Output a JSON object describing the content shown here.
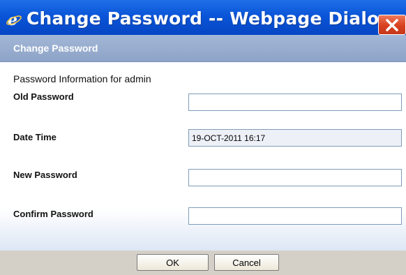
{
  "window": {
    "title": "Change Password -- Webpage Dialog",
    "app_icon": "ie-icon",
    "close_icon": "close-icon"
  },
  "header": {
    "title": "Change Password"
  },
  "form": {
    "info": "Password Information for admin",
    "old_password": {
      "label": "Old Password",
      "value": ""
    },
    "date_time": {
      "label": "Date Time",
      "value": "19-OCT-2011 16:17"
    },
    "new_password": {
      "label": "New Password",
      "value": ""
    },
    "confirm_password": {
      "label": "Confirm Password",
      "value": ""
    }
  },
  "buttons": {
    "ok": "OK",
    "cancel": "Cancel"
  },
  "colors": {
    "titlebar": "#0a55d8",
    "header_bar": "#9aaed0",
    "close_button": "#d7401f",
    "footer": "#d4d0c8"
  }
}
